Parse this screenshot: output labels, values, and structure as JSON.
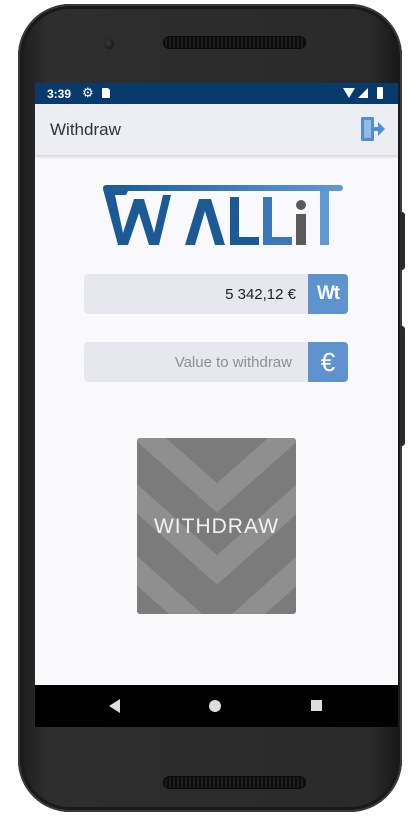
{
  "status_bar": {
    "time": "3:39",
    "icons": [
      "settings-icon",
      "sd-card-icon",
      "wifi-icon",
      "signal-icon",
      "battery-icon"
    ]
  },
  "app_bar": {
    "title": "Withdraw",
    "action_icon": "exit-icon"
  },
  "logo": {
    "text": "WALLiT",
    "colors": {
      "primary": "#1c5a95",
      "secondary": "#5a5a5a"
    }
  },
  "balance": {
    "value": "5 342,12 €",
    "badge_label": "Wt"
  },
  "withdraw_input": {
    "value": "",
    "placeholder": "Value to withdraw",
    "badge_label": "€"
  },
  "withdraw_button": {
    "label": "WITHDRAW"
  },
  "nav_bar": {
    "icons": [
      "back-icon",
      "home-icon",
      "recents-icon"
    ]
  },
  "colors": {
    "status_bar": "#083a6e",
    "accent": "#5e93cf",
    "button": "#7b7b7b"
  }
}
